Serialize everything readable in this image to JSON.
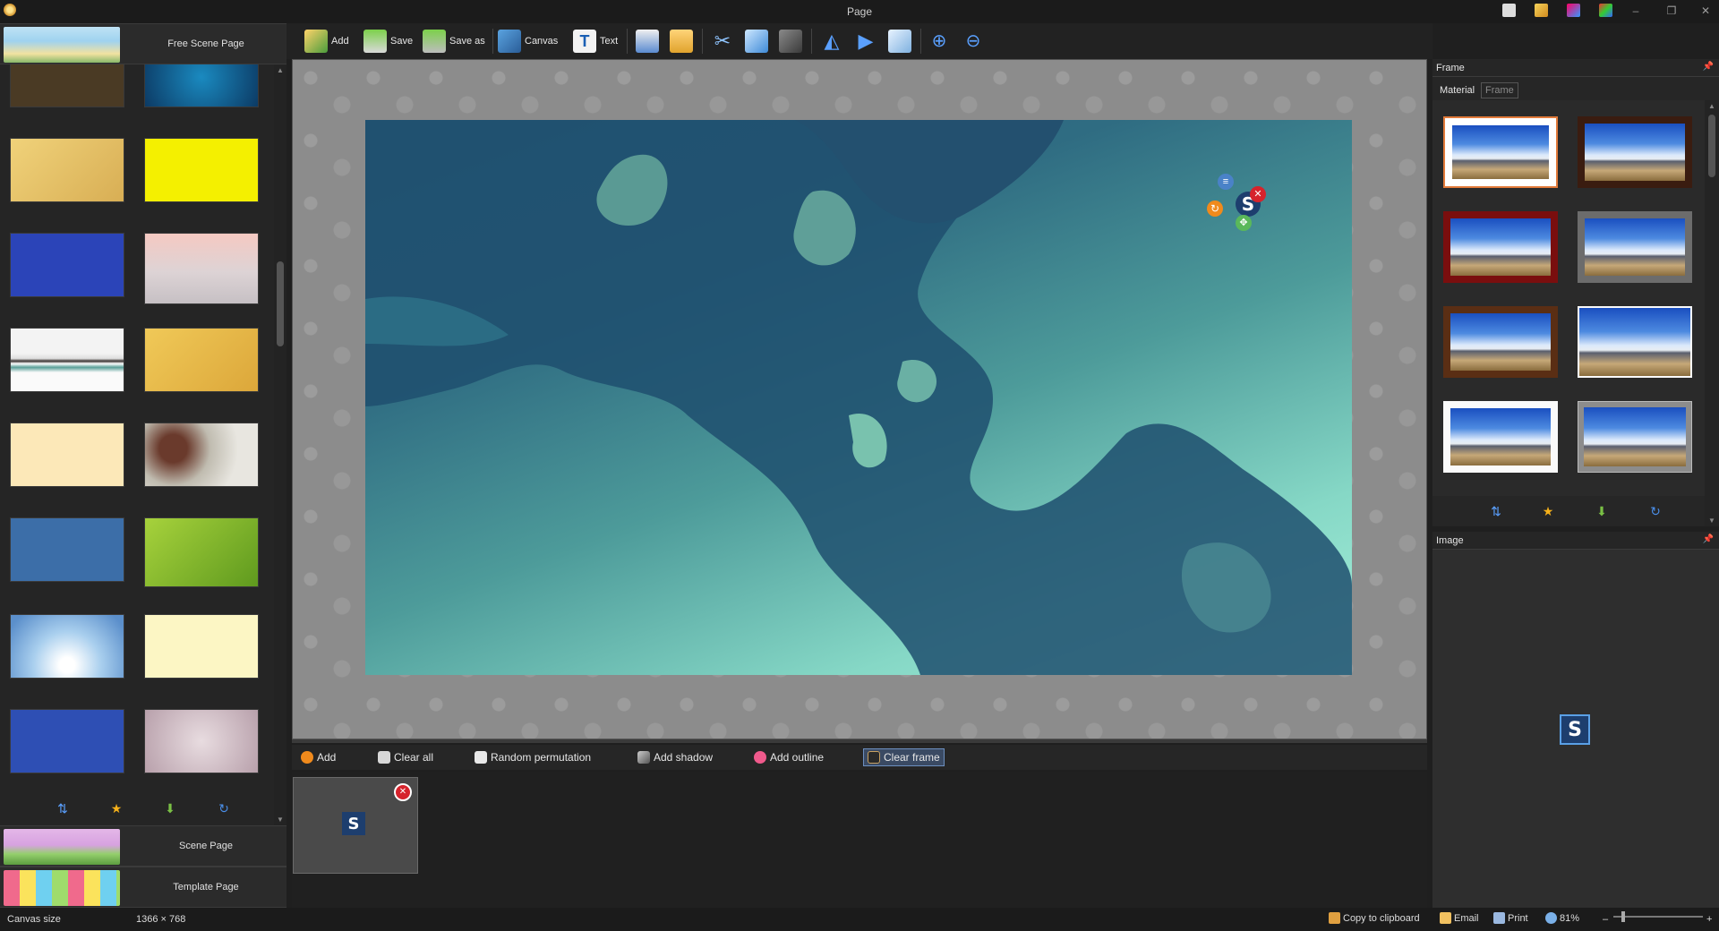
{
  "window": {
    "title": "Page",
    "minimize_glyph": "–",
    "restore_glyph": "❐",
    "close_glyph": "✕"
  },
  "left_panel": {
    "free_scene_label": "Free Scene Page",
    "scene_label": "Scene Page",
    "template_label": "Template Page",
    "tool_icons": [
      "sort-icon",
      "star-icon",
      "download-icon",
      "refresh-icon"
    ]
  },
  "toolbar": {
    "add": "Add",
    "save": "Save",
    "save_as": "Save as",
    "canvas": "Canvas",
    "text": "Text"
  },
  "bottom_toolbar": {
    "add": "Add",
    "clear_all": "Clear all",
    "random_permutation": "Random permutation",
    "add_shadow": "Add shadow",
    "add_outline": "Add outline",
    "clear_frame": "Clear frame"
  },
  "right_panel": {
    "frame_title": "Frame",
    "material_tab": "Material",
    "frame_tab": "Frame",
    "image_title": "Image"
  },
  "layer": {
    "logo_letter": "S"
  },
  "status": {
    "canvas_size_label": "Canvas size",
    "canvas_size_value": "1366 × 768",
    "copy_to_clipboard": "Copy to clipboard",
    "email": "Email",
    "print": "Print",
    "zoom": "81%",
    "zoom_out": "–",
    "zoom_in": "+"
  },
  "colors": {
    "accent": "#6c8fbf",
    "panel_bg": "#252525",
    "canvas_teal": "#2f6c82",
    "delete_red": "#d6232c"
  }
}
